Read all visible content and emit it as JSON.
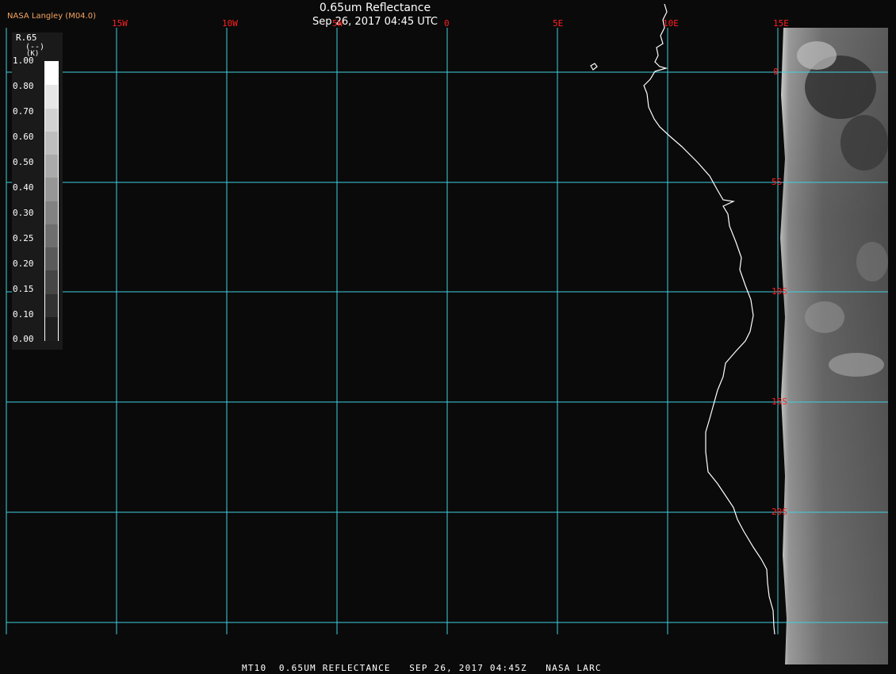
{
  "header": {
    "credit": "NASA Langley (M04.0)",
    "title": "0.65um Reflectance",
    "timestamp": "Sep 26, 2017 04:45 UTC"
  },
  "footer": {
    "caption": "MT10  0.65UM REFLECTANCE   SEP 26, 2017 04:45Z   NASA LARC"
  },
  "legend": {
    "title": "R.65",
    "units": "(--)",
    "unit_k": "(K)",
    "ticks": [
      "1.00",
      "0.80",
      "0.70",
      "0.60",
      "0.50",
      "0.40",
      "0.30",
      "0.25",
      "0.20",
      "0.15",
      "0.10",
      "0.00"
    ]
  },
  "grid": {
    "lon_labels": [
      "15W",
      "10W",
      "5W",
      "0",
      "5E",
      "10E",
      "15E"
    ],
    "lat_labels": [
      "0",
      "5S",
      "10S",
      "15S",
      "20S"
    ]
  },
  "colors": {
    "grid": "#40d0e0",
    "labels": "#ff2020",
    "coast": "#ffffff",
    "background": "#0a0a0a"
  }
}
